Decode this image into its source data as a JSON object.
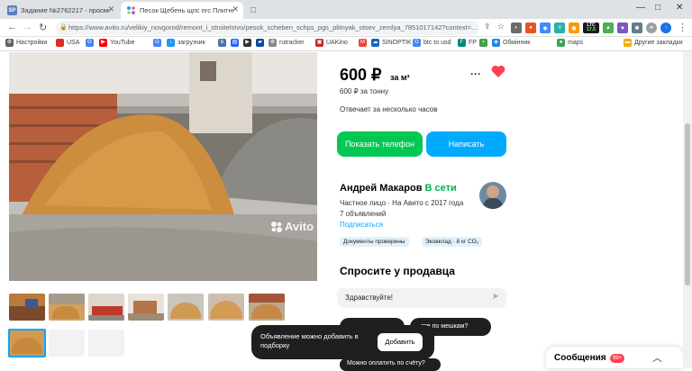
{
  "browser": {
    "tabs": [
      {
        "label": "Задание №2762217 - просмотр з",
        "favicon_text": "SP"
      },
      {
        "label": "Песок Щебень щпс пгс Плитняк",
        "favicon_text": ""
      }
    ],
    "url": "https://www.avito.ru/velikiy_novgorod/remont_i_stroitelstvo/pesok_scheben_schps_pgs_plitnyak_otsev_zemlya_7851017142?context=..."
  },
  "bookmarks": {
    "items": [
      "Настройки",
      "USA",
      "",
      "YouTube",
      "",
      "загрузчик",
      "",
      "",
      "",
      "",
      "rutracker",
      "UAKino",
      "",
      "SINOPTIK",
      "btc to usd",
      "FP",
      "",
      "Обмінник",
      "maps"
    ],
    "other_label": "Другие закладки"
  },
  "extensions": {
    "ltc_value": "LTC",
    "ltc_price": "17.5"
  },
  "photo": {
    "watermark": "Avito"
  },
  "listing": {
    "price": "600 ₽",
    "price_unit": "за м³",
    "price_per_ton": "600 ₽ за тонну",
    "response_time": "Отвечает за несколько часов",
    "show_phone_label": "Показать телефон",
    "write_label": "Написать"
  },
  "seller": {
    "name": "Андрей Макаров",
    "online_status": "В сети",
    "info": "Частное лицо · На Авито с 2017 года",
    "ads_count": "7 объявлений",
    "subscribe_label": "Подписаться",
    "badges": [
      "Документы проверены",
      "Эковклад · 8 кг CO₂"
    ]
  },
  "ask": {
    "title": "Спросите у продавца",
    "input_value": "Здравствуйте!",
    "suggestions": [
      "ете по мешкам?",
      "Можно оплатить по счёту?"
    ]
  },
  "notice": {
    "text": "Объявление можно добавить в подборку",
    "button_label": "Добавить"
  },
  "messages": {
    "label": "Сообщения",
    "badge": "99+"
  },
  "colors": {
    "accent_green": "#00c853",
    "accent_blue": "#00aaff",
    "heart": "#ff4053",
    "online": "#00b34d"
  }
}
